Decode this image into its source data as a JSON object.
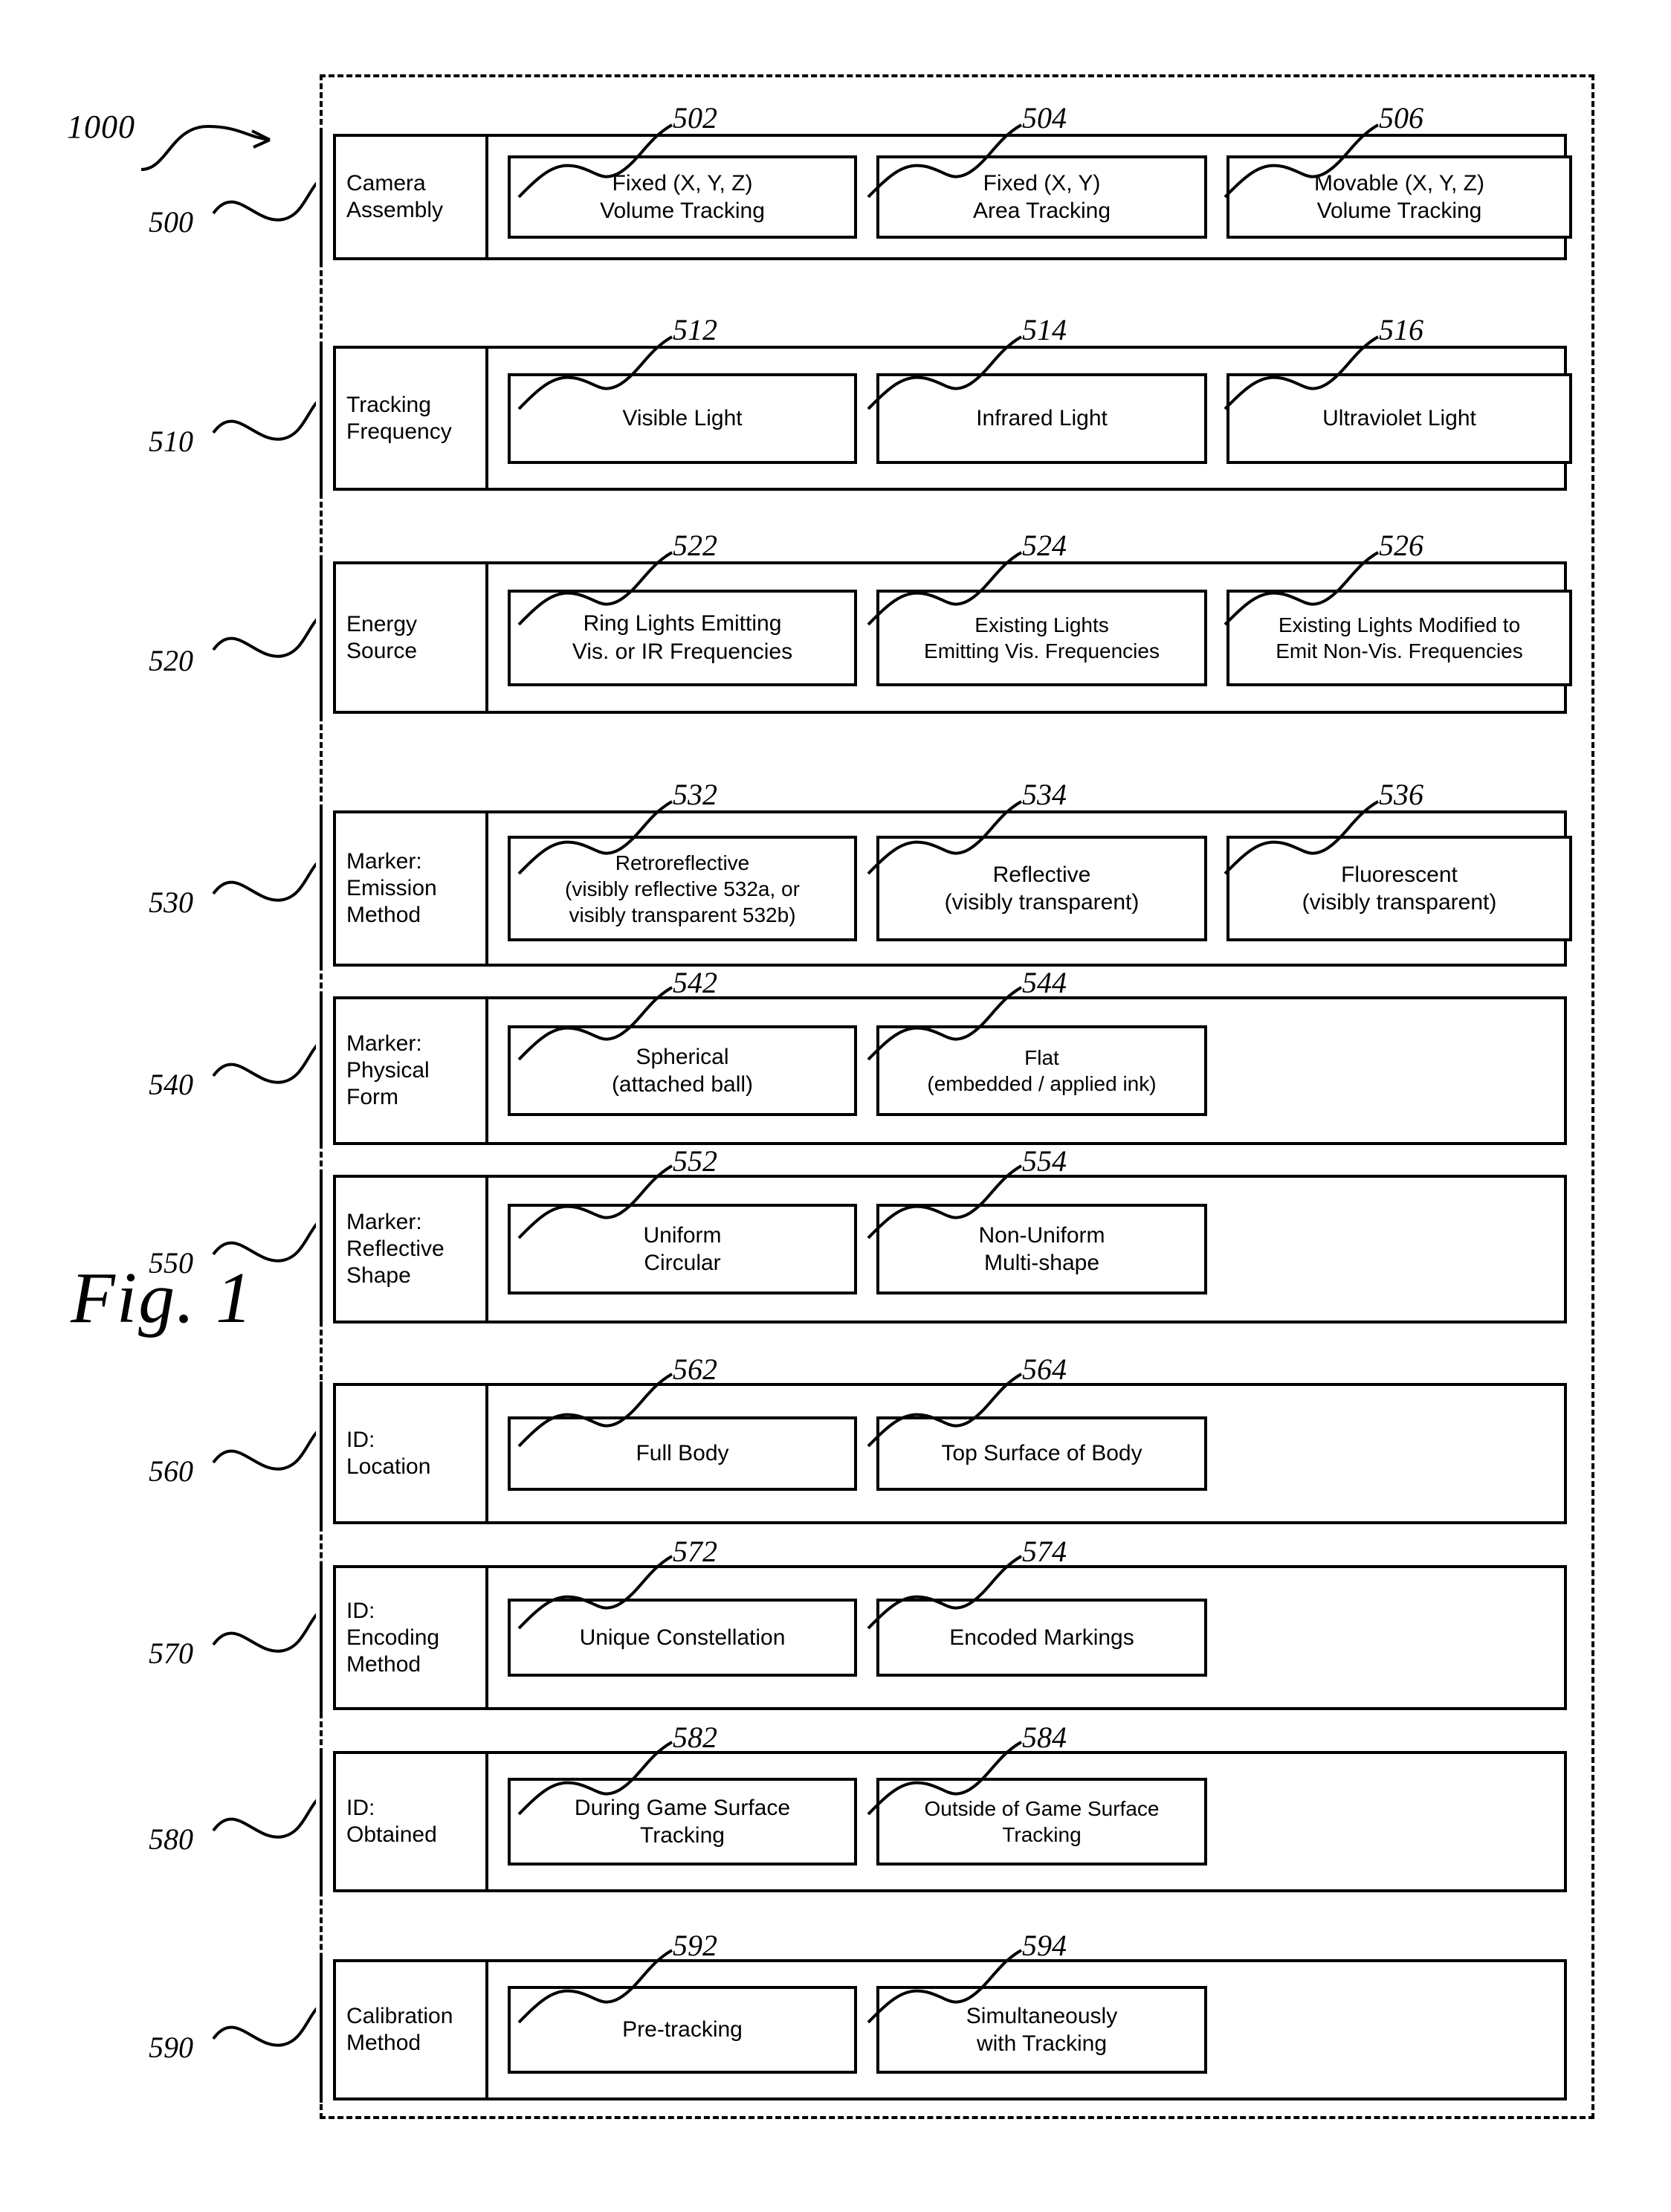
{
  "figure": {
    "caption": "Fig. 1",
    "system_ref": "1000"
  },
  "rows": [
    {
      "ref": "500",
      "label": "Camera\nAssembly",
      "options": [
        {
          "ref": "502",
          "text": "Fixed (X, Y, Z)\nVolume Tracking"
        },
        {
          "ref": "504",
          "text": "Fixed (X, Y)\nArea Tracking"
        },
        {
          "ref": "506",
          "text": "Movable (X, Y, Z)\nVolume Tracking"
        }
      ]
    },
    {
      "ref": "510",
      "label": "Tracking\nFrequency",
      "options": [
        {
          "ref": "512",
          "text": "Visible Light"
        },
        {
          "ref": "514",
          "text": "Infrared Light"
        },
        {
          "ref": "516",
          "text": "Ultraviolet Light"
        }
      ]
    },
    {
      "ref": "520",
      "label": "Energy\nSource",
      "options": [
        {
          "ref": "522",
          "text": "Ring Lights Emitting\nVis. or IR Frequencies"
        },
        {
          "ref": "524",
          "text": "Existing Lights\nEmitting Vis. Frequencies"
        },
        {
          "ref": "526",
          "text": "Existing Lights Modified to\nEmit Non-Vis. Frequencies"
        }
      ]
    },
    {
      "ref": "530",
      "label": "Marker:\nEmission\nMethod",
      "options": [
        {
          "ref": "532",
          "text": "Retroreflective\n(visibly reflective 532a, or\nvisibly transparent 532b)"
        },
        {
          "ref": "534",
          "text": "Reflective\n(visibly transparent)"
        },
        {
          "ref": "536",
          "text": "Fluorescent\n(visibly transparent)"
        }
      ]
    },
    {
      "ref": "540",
      "label": "Marker:\nPhysical\nForm",
      "options": [
        {
          "ref": "542",
          "text": "Spherical\n(attached ball)"
        },
        {
          "ref": "544",
          "text": "Flat\n(embedded / applied ink)"
        }
      ]
    },
    {
      "ref": "550",
      "label": "Marker:\nReflective\nShape",
      "options": [
        {
          "ref": "552",
          "text": "Uniform\nCircular"
        },
        {
          "ref": "554",
          "text": "Non-Uniform\nMulti-shape"
        }
      ]
    },
    {
      "ref": "560",
      "label": "ID:\nLocation",
      "options": [
        {
          "ref": "562",
          "text": "Full Body"
        },
        {
          "ref": "564",
          "text": "Top Surface of Body"
        }
      ]
    },
    {
      "ref": "570",
      "label": "ID:\nEncoding\nMethod",
      "options": [
        {
          "ref": "572",
          "text": "Unique Constellation"
        },
        {
          "ref": "574",
          "text": "Encoded Markings"
        }
      ]
    },
    {
      "ref": "580",
      "label": "ID:\nObtained",
      "options": [
        {
          "ref": "582",
          "text": "During Game Surface\nTracking"
        },
        {
          "ref": "584",
          "text": "Outside of Game Surface\nTracking"
        }
      ]
    },
    {
      "ref": "590",
      "label": "Calibration\nMethod",
      "options": [
        {
          "ref": "592",
          "text": "Pre-tracking"
        },
        {
          "ref": "594",
          "text": "Simultaneously\nwith Tracking"
        }
      ]
    }
  ],
  "colors": {
    "ink": "#000000",
    "paper": "#ffffff"
  }
}
